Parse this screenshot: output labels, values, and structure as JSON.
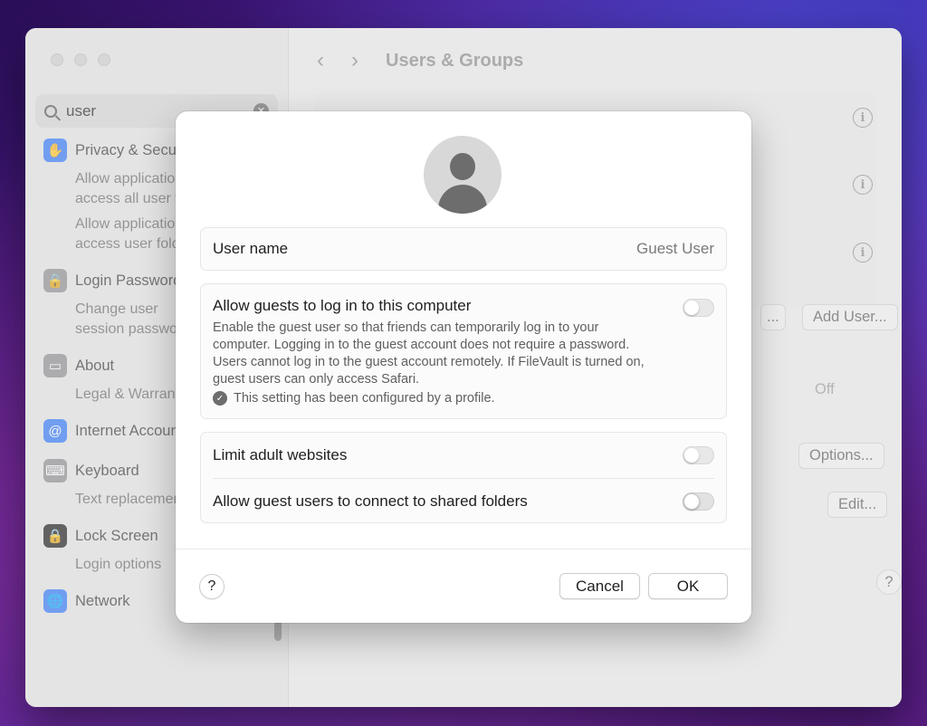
{
  "background_window": {
    "search": {
      "value": "user"
    },
    "sidebar": {
      "items": [
        {
          "label": "Privacy & Security",
          "icon": "hand-icon",
          "color": "#3478f6",
          "subs": [
            "Allow applications to\naccess all user files",
            "Allow applications to\naccess user folders"
          ]
        },
        {
          "label": "Login Password",
          "icon": "lock-icon",
          "color": "#8e8e93",
          "subs": [
            "Change user\nsession password"
          ]
        },
        {
          "label": "About",
          "icon": "display-icon",
          "color": "#8e8e93",
          "subs": [
            "Legal & Warranty"
          ]
        },
        {
          "label": "Internet Accounts",
          "icon": "at-icon",
          "color": "#3478f6",
          "subs": []
        },
        {
          "label": "Keyboard",
          "icon": "keyboard-icon",
          "color": "#8e8e93",
          "subs": [
            "Text replacements"
          ]
        },
        {
          "label": "Lock Screen",
          "icon": "lock-screen-icon",
          "color": "#1c1c1e",
          "subs": [
            "Login options"
          ]
        },
        {
          "label": "Network",
          "icon": "globe-icon",
          "color": "#3478f6",
          "subs": []
        }
      ]
    },
    "header": {
      "title": "Users & Groups"
    },
    "buttons": {
      "add_user": "Add User...",
      "ellipsis": "...",
      "off_value": "Off",
      "options": "Options...",
      "edit": "Edit...",
      "help": "?"
    }
  },
  "sheet": {
    "username_label": "User name",
    "username_value": "Guest User",
    "allow_guests_title": "Allow guests to log in to this computer",
    "allow_guests_desc": "Enable the guest user so that friends can temporarily log in to your computer. Logging in to the guest account does not require a password. Users cannot log in to the guest account remotely. If FileVault is turned on, guest users can only access Safari.",
    "profile_note": "This setting has been configured by a profile.",
    "limit_adult": "Limit adult websites",
    "shared_folders": "Allow guest users to connect to shared folders",
    "help": "?",
    "cancel": "Cancel",
    "ok": "OK",
    "toggles": {
      "allow_guests": false,
      "limit_adult": false,
      "shared_folders": false
    }
  }
}
